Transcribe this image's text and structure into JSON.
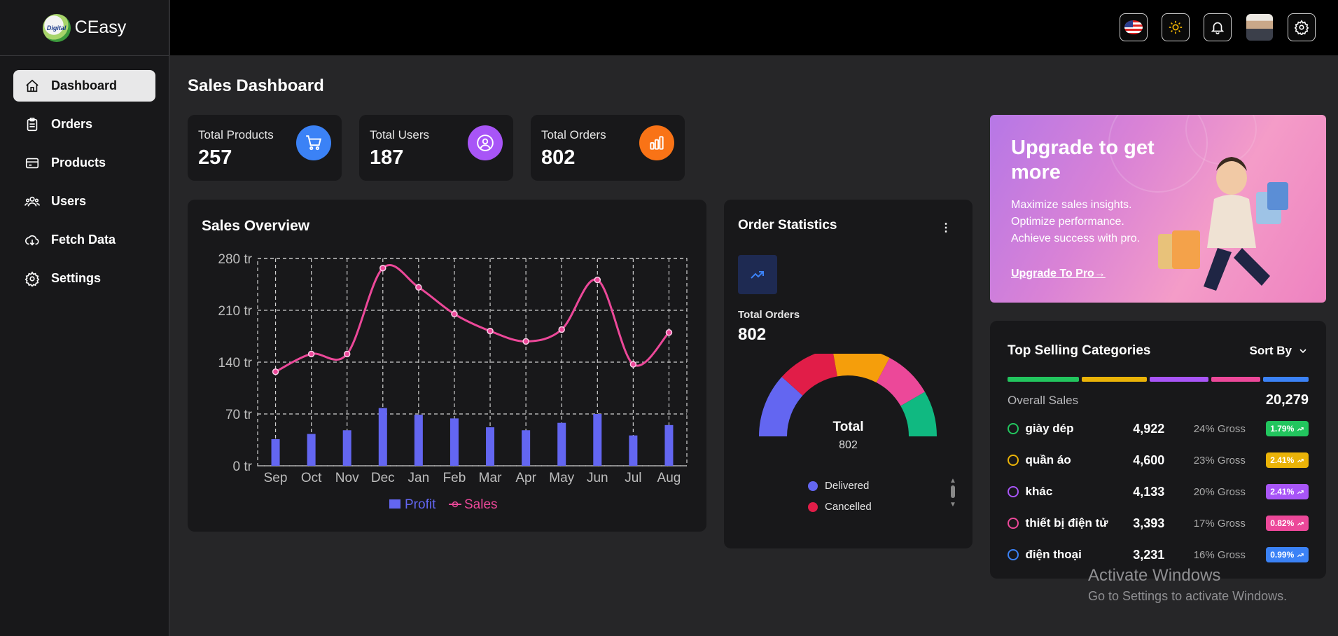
{
  "brand": {
    "name": "CEasy",
    "logo_text": "Digital"
  },
  "sidebar": {
    "items": [
      {
        "label": "Dashboard",
        "icon": "home-icon",
        "active": true
      },
      {
        "label": "Orders",
        "icon": "clipboard-icon",
        "active": false
      },
      {
        "label": "Products",
        "icon": "card-icon",
        "active": false
      },
      {
        "label": "Users",
        "icon": "users-icon",
        "active": false
      },
      {
        "label": "Fetch Data",
        "icon": "cloud-download-icon",
        "active": false
      },
      {
        "label": "Settings",
        "icon": "gear-icon",
        "active": false
      }
    ]
  },
  "header": {
    "buttons": [
      "us-flag-icon",
      "sun-icon",
      "bell-icon",
      "avatar",
      "gear-icon"
    ]
  },
  "main": {
    "title": "Sales Dashboard",
    "stats": [
      {
        "label": "Total Products",
        "value": "257",
        "color": "#3b82f6",
        "icon": "cart-icon"
      },
      {
        "label": "Total Users",
        "value": "187",
        "color": "#a855f7",
        "icon": "user-circle-icon"
      },
      {
        "label": "Total Orders",
        "value": "802",
        "color": "#f97316",
        "icon": "bar-chart-icon"
      }
    ]
  },
  "sales_overview": {
    "title": "Sales Overview",
    "chart_data": {
      "type": "bar",
      "categories": [
        "Sep",
        "Oct",
        "Nov",
        "Dec",
        "Jan",
        "Feb",
        "Mar",
        "Apr",
        "May",
        "Jun",
        "Jul",
        "Aug"
      ],
      "y_ticks": [
        "0 tr",
        "70 tr",
        "140 tr",
        "210 tr",
        "280 tr"
      ],
      "ylim": [
        0,
        280
      ],
      "grid": true,
      "legend": "bottom",
      "series": [
        {
          "name": "Profit",
          "type": "bar",
          "color": "#6366f1",
          "values": [
            36,
            43,
            48,
            78,
            69,
            64,
            52,
            48,
            58,
            70,
            41,
            55
          ]
        },
        {
          "name": "Sales",
          "type": "line",
          "color": "#ec4899",
          "values": [
            127,
            151,
            151,
            267,
            241,
            205,
            182,
            168,
            184,
            251,
            137,
            180
          ]
        }
      ]
    }
  },
  "order_statistics": {
    "title": "Order Statistics",
    "total_label": "Total Orders",
    "total_value": "802",
    "center_label": "Total",
    "center_value": "802",
    "segments": [
      {
        "name": "Delivered",
        "color": "#6366f1"
      },
      {
        "name": "Cancelled",
        "color": "#e11d48"
      },
      {
        "color": "#f59e0b"
      },
      {
        "color": "#ec4899"
      },
      {
        "color": "#10b981"
      }
    ]
  },
  "upgrade": {
    "title": "Upgrade to get more",
    "lines": [
      "Maximize sales insights.",
      "Optimize performance.",
      "Achieve success with pro."
    ],
    "link": "Upgrade To Pro→"
  },
  "top_selling": {
    "title": "Top Selling Categories",
    "sort_label": "Sort By",
    "overall_label": "Overall Sales",
    "overall_value": "20,279",
    "bar_colors": [
      "#22c55e",
      "#eab308",
      "#a855f7",
      "#ec4899",
      "#3b82f6"
    ],
    "rows": [
      {
        "name": "giày dép",
        "qty": "4,922",
        "gross": "24% Gross",
        "badge": "1.79%",
        "color": "#22c55e"
      },
      {
        "name": "quần áo",
        "qty": "4,600",
        "gross": "23% Gross",
        "badge": "2.41%",
        "color": "#eab308"
      },
      {
        "name": "khác",
        "qty": "4,133",
        "gross": "20% Gross",
        "badge": "2.41%",
        "color": "#a855f7"
      },
      {
        "name": "thiết bị điện tử",
        "qty": "3,393",
        "gross": "17% Gross",
        "badge": "0.82%",
        "color": "#ec4899"
      },
      {
        "name": "điện thoại",
        "qty": "3,231",
        "gross": "16% Gross",
        "badge": "0.99%",
        "color": "#3b82f6"
      }
    ]
  },
  "watermark": {
    "line1": "Activate Windows",
    "line2": "Go to Settings to activate Windows."
  }
}
